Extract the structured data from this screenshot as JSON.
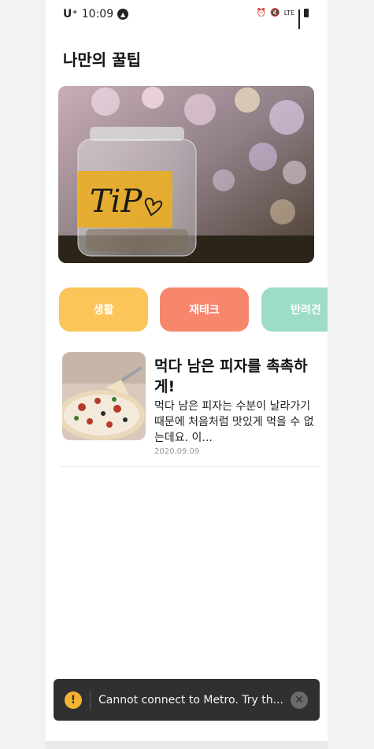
{
  "status_bar": {
    "carrier": "U⁺",
    "time": "10:09",
    "network": "LTE"
  },
  "page": {
    "title": "나만의 꿀팁"
  },
  "hero": {
    "label_text": "TiP"
  },
  "categories": [
    {
      "label": "생활",
      "color": "#fcc55a"
    },
    {
      "label": "재테크",
      "color": "#f8866c"
    },
    {
      "label": "반려견",
      "color": "#9ddcc6"
    }
  ],
  "article": {
    "title": "먹다 남은 피자를 촉촉하게!",
    "body": "먹다 남은 피자는 수분이 날라가기 때문에 처음처럼 맛있게 먹을 수 없는데요. 이...",
    "date": "2020.09.09"
  },
  "toast": {
    "message": "Cannot connect to Metro.  Try th...",
    "icon": "warning-icon",
    "close_icon": "close-icon"
  }
}
